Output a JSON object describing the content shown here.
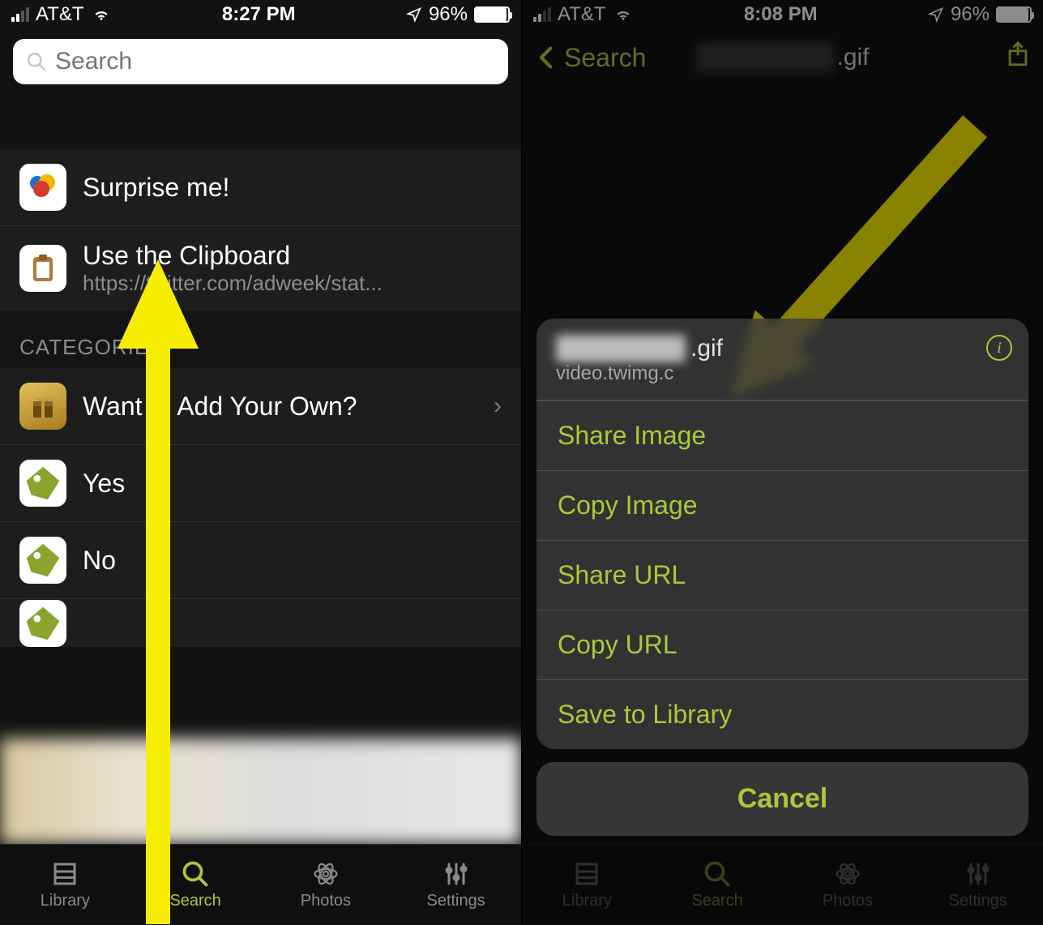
{
  "status": {
    "carrier": "AT&T",
    "battery_pct": "96%",
    "location_on": true
  },
  "left": {
    "time": "8:27 PM",
    "search_placeholder": "Search",
    "items": {
      "surprise": "Surprise me!",
      "clipboard_title": "Use the Clipboard",
      "clipboard_sub": "https://twitter.com/adweek/stat..."
    },
    "section_categories": "CATEGORIES",
    "categories": {
      "add_own": "Want to Add Your Own?",
      "yes": "Yes",
      "no": "No"
    },
    "tabs": [
      "Library",
      "Search",
      "Photos",
      "Settings"
    ],
    "active_tab_index": 1
  },
  "right": {
    "time": "8:08 PM",
    "back_label": "Search",
    "title_suffix": ".gif",
    "sheet": {
      "filename_suffix": ".gif",
      "host": "video.twimg.c",
      "actions": [
        "Share Image",
        "Copy Image",
        "Share URL",
        "Copy URL",
        "Save to Library"
      ],
      "cancel": "Cancel"
    },
    "tabs": [
      "Library",
      "Search",
      "Photos",
      "Settings"
    ],
    "active_tab_index": 1
  },
  "accent": "#a9c93a",
  "arrow_color": "#f7ed00"
}
